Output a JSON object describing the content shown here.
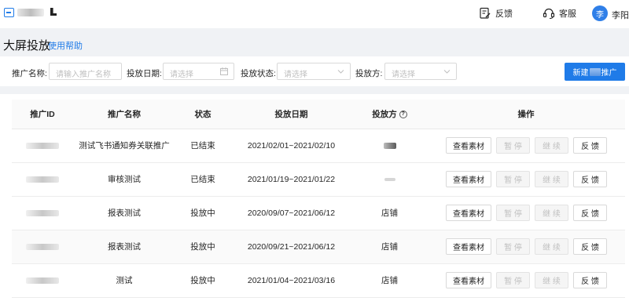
{
  "topbar": {
    "feedback_label": "反馈",
    "service_label": "客服",
    "avatar_char": "李",
    "user_name": "李阳"
  },
  "header": {
    "title": "大屏投放",
    "help_label": "使用帮助"
  },
  "filters": {
    "name_label": "推广名称:",
    "name_placeholder": "请输入推广名称",
    "date_label": "投放日期:",
    "date_placeholder": "请选择",
    "status_label": "投放状态:",
    "status_placeholder": "请选择",
    "party_label": "投放方:",
    "party_placeholder": "请选择",
    "new_button_prefix": "新建",
    "new_button_suffix": "推广"
  },
  "table": {
    "columns": [
      "推广ID",
      "推广名称",
      "状态",
      "投放日期",
      "投放方",
      "操作"
    ],
    "rows": [
      {
        "name": "测试飞书通知券关联推广",
        "status": "已结束",
        "date": "2021/02/01~2021/02/10",
        "party": ""
      },
      {
        "name": "审核测试",
        "status": "已结束",
        "date": "2021/01/19~2021/01/22",
        "party": ""
      },
      {
        "name": "报表测试",
        "status": "投放中",
        "date": "2020/09/07~2021/06/12",
        "party": "店铺"
      },
      {
        "name": "报表测试",
        "status": "投放中",
        "date": "2020/09/21~2021/06/12",
        "party": "店铺"
      },
      {
        "name": "测试",
        "status": "投放中",
        "date": "2021/01/04~2021/03/16",
        "party": "店铺"
      }
    ],
    "actions": {
      "view": "查看素材",
      "pause": "暂 停",
      "resume": "继 续",
      "feedback": "反 馈"
    }
  },
  "colors": {
    "primary": "#1f7be8",
    "background": "#f0f2f5"
  }
}
